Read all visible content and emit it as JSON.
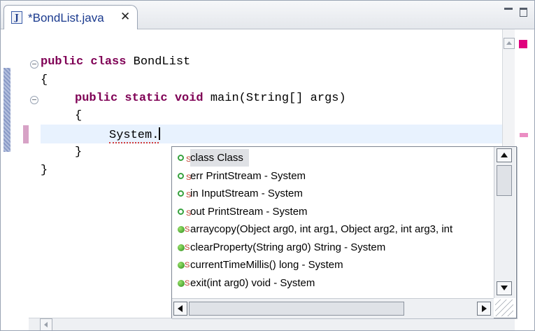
{
  "tab": {
    "icon": "java-file-icon",
    "icon_letter": "J",
    "label": "*BondList.java",
    "close": "✕"
  },
  "window_controls": [
    "minimize-icon",
    "maximize-icon"
  ],
  "code": {
    "line1_kw": "public class",
    "line1_rest": " BondList",
    "line2": "{",
    "line3_kw": "public static void",
    "line3_rest": " main(String[] args)",
    "line4": "{",
    "line5_token": "System.",
    "line6": "}",
    "line7": "}"
  },
  "assist": {
    "items": [
      {
        "icon": "static-field-icon",
        "static": "S",
        "text": "class   Class"
      },
      {
        "icon": "static-field-icon",
        "static": "S",
        "text": "err   PrintStream - System"
      },
      {
        "icon": "static-field-icon",
        "static": "S",
        "text": "in   InputStream - System"
      },
      {
        "icon": "static-field-icon",
        "static": "S",
        "text": "out   PrintStream - System"
      },
      {
        "icon": "static-method-icon",
        "static": "S",
        "text": "arraycopy(Object arg0, int arg1, Object arg2, int arg3, int"
      },
      {
        "icon": "static-method-icon",
        "static": "S",
        "text": "clearProperty(String arg0)  String - System"
      },
      {
        "icon": "static-method-icon",
        "static": "S",
        "text": "currentTimeMillis()  long - System"
      },
      {
        "icon": "static-method-icon",
        "static": "S",
        "text": "exit(int arg0)  void - System"
      }
    ],
    "selected_index": 0
  },
  "colors": {
    "keyword": "#7f0055",
    "current_line": "#e8f2fe",
    "selection": "#dfe1e5",
    "error_underline": "#d23b3b",
    "overview_error": "#e0007d"
  }
}
